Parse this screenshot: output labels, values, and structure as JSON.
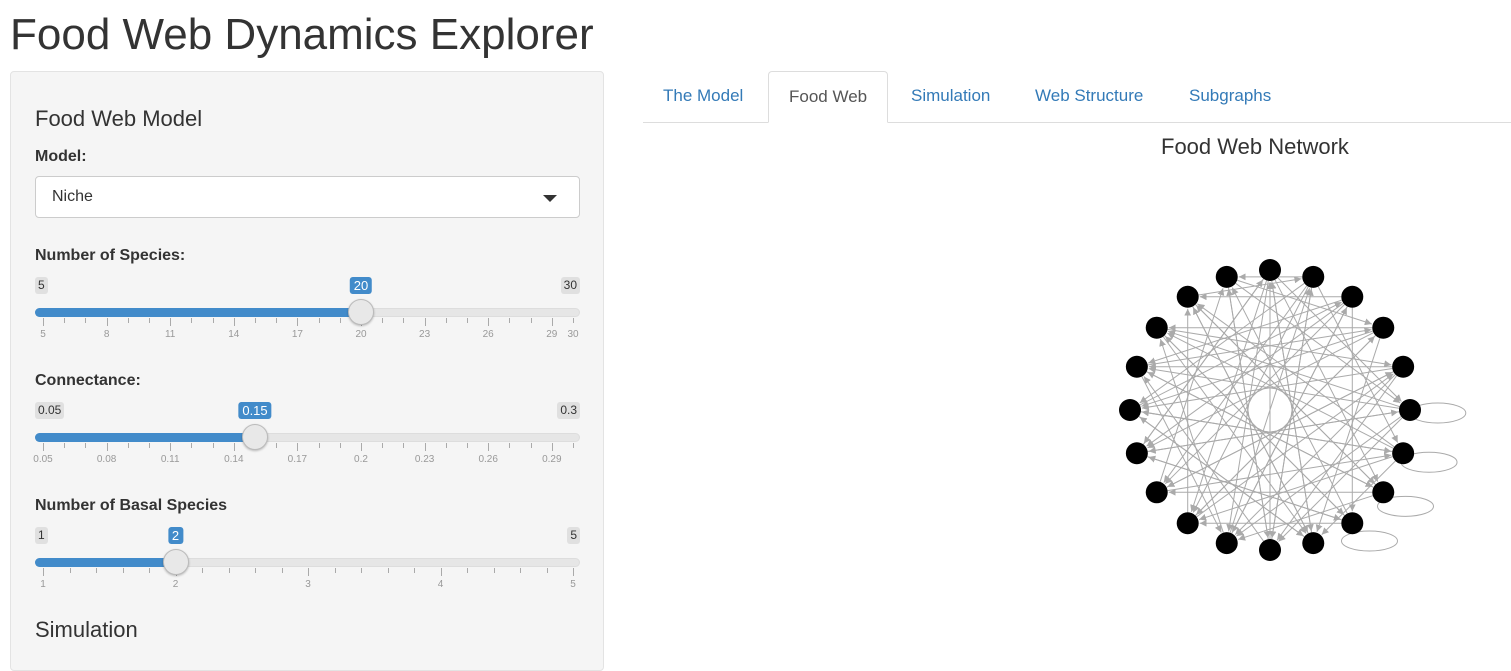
{
  "app": {
    "title": "Food Web Dynamics Explorer"
  },
  "sidebar": {
    "model_section": "Food Web Model",
    "model_label": "Model:",
    "model_value": "Niche",
    "species": {
      "label": "Number of Species:",
      "min": 5,
      "max": 30,
      "value": 20,
      "min_label": "5",
      "max_label": "30",
      "value_label": "20",
      "tick_labels": [
        "5",
        "8",
        "11",
        "14",
        "17",
        "20",
        "23",
        "26",
        "29",
        "30"
      ]
    },
    "connectance": {
      "label": "Connectance:",
      "min": 0.05,
      "max": 0.3,
      "value": 0.15,
      "min_label": "0.05",
      "max_label": "0.3",
      "value_label": "0.15",
      "tick_labels": [
        "0.05",
        "0.08",
        "0.11",
        "0.14",
        "0.17",
        "0.2",
        "0.23",
        "0.26",
        "0.29"
      ]
    },
    "basal": {
      "label": "Number of Basal Species",
      "min": 1,
      "max": 5,
      "value": 2,
      "min_label": "1",
      "max_label": "5",
      "value_label": "2",
      "tick_labels": [
        "1",
        "2",
        "3",
        "4",
        "5"
      ]
    },
    "simulation_section": "Simulation"
  },
  "tabs": [
    {
      "label": "The Model",
      "active": false
    },
    {
      "label": "Food Web",
      "active": true
    },
    {
      "label": "Simulation",
      "active": false
    },
    {
      "label": "Web Structure",
      "active": false
    },
    {
      "label": "Subgraphs",
      "active": false
    }
  ],
  "network": {
    "title": "Food Web Network",
    "node_count": 20,
    "node_color": "#000000",
    "edge_color": "#aaaaaa",
    "accent": "#428bca"
  }
}
